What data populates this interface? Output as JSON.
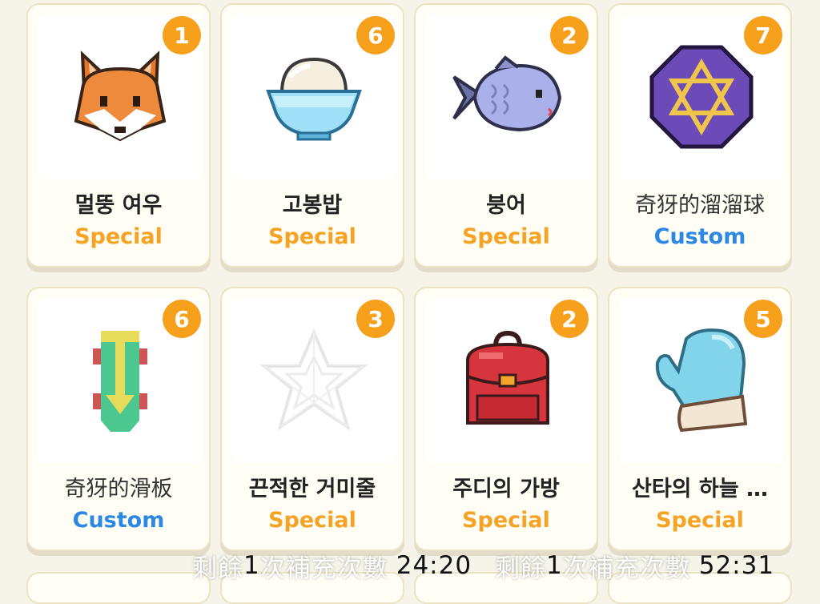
{
  "items": [
    {
      "name": "멀뚱 여우",
      "type": "Special",
      "count": "1",
      "icon": "fox-icon"
    },
    {
      "name": "고봉밥",
      "type": "Special",
      "count": "6",
      "icon": "rice-bowl-icon"
    },
    {
      "name": "붕어",
      "type": "Special",
      "count": "2",
      "icon": "fish-icon"
    },
    {
      "name": "奇犽的溜溜球",
      "type": "Custom",
      "count": "7",
      "icon": "star-medallion-icon"
    },
    {
      "name": "奇犽的滑板",
      "type": "Custom",
      "count": "6",
      "icon": "skateboard-icon"
    },
    {
      "name": "끈적한 거미줄",
      "type": "Special",
      "count": "3",
      "icon": "spider-web-icon"
    },
    {
      "name": "주디의 가방",
      "type": "Special",
      "count": "2",
      "icon": "backpack-icon"
    },
    {
      "name": "산타의 하늘 …",
      "type": "Special",
      "count": "5",
      "icon": "mitten-icon"
    }
  ],
  "overlays": [
    {
      "prefix": "剩餘",
      "num": "1",
      "suffix": "次補充次數",
      "time": "24:20"
    },
    {
      "prefix": "剩餘",
      "num": "1",
      "suffix": "次補充次數",
      "time": "52:31"
    }
  ],
  "colors": {
    "special": "#f5a324",
    "custom": "#2b88e4",
    "badge": "#f7a01c"
  }
}
